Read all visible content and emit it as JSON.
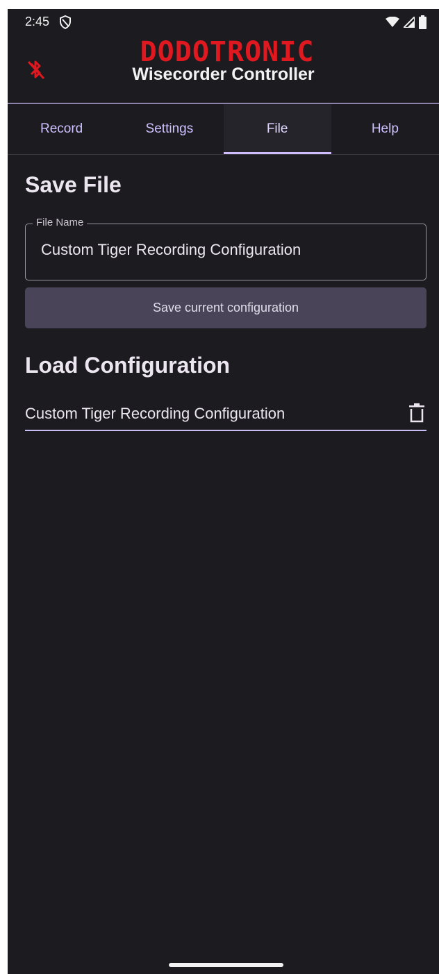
{
  "status_bar": {
    "time": "2:45",
    "icons": [
      "shield-icon",
      "wifi-icon",
      "signal-icon",
      "battery-icon"
    ]
  },
  "header": {
    "brand": "DODOTRONIC",
    "subtitle": "Wisecorder Controller",
    "left_icon": "bluetooth-off-icon"
  },
  "tabs": [
    {
      "label": "Record",
      "active": false
    },
    {
      "label": "Settings",
      "active": false
    },
    {
      "label": "File",
      "active": true
    },
    {
      "label": "Help",
      "active": false
    }
  ],
  "save_section": {
    "title": "Save File",
    "field_label": "File Name",
    "field_value": "Custom Tiger Recording Configuration",
    "button_label": "Save current configuration"
  },
  "load_section": {
    "title": "Load Configuration",
    "items": [
      {
        "label": "Custom Tiger Recording Configuration",
        "action_icon": "trash-icon"
      }
    ]
  },
  "colors": {
    "background": "#1c1b1f",
    "accent": "#cfbdfe",
    "brand": "#e01820",
    "button": "#4a4458"
  }
}
